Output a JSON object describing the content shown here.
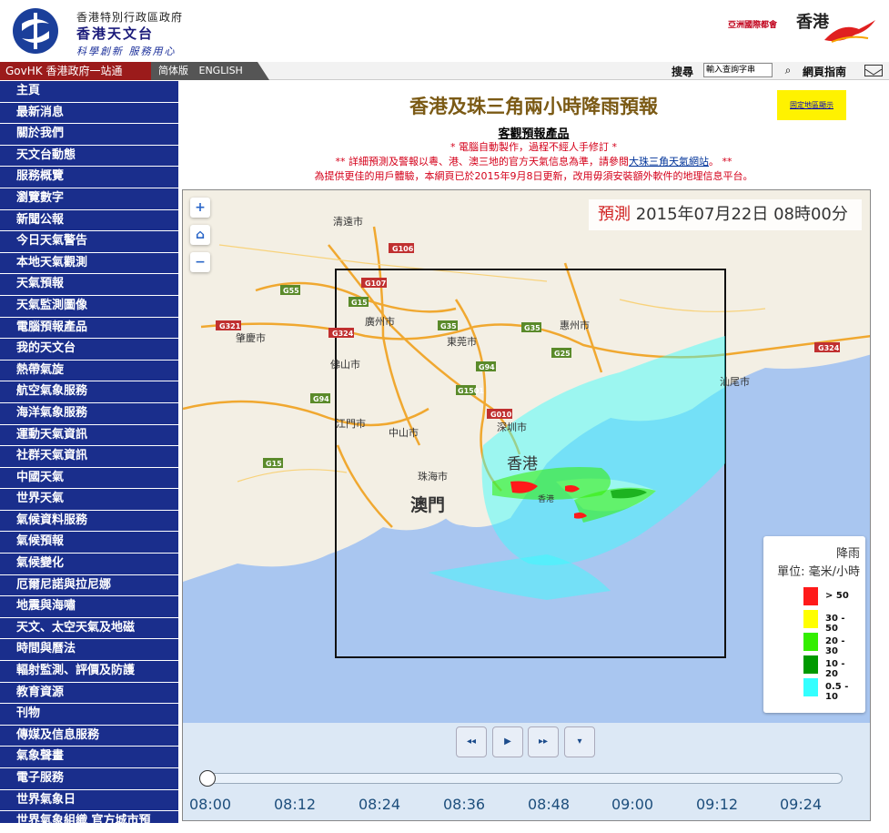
{
  "header": {
    "org_line1": "香港特別行政區政府",
    "org_line2": "香港天文台",
    "motto": "科學創新 服務用心",
    "asia_text": "亞洲國際都會",
    "brand": "香港"
  },
  "topbar": {
    "govhk": "GovHK 香港政府一站通",
    "lang_simplified": "简体版",
    "lang_english": "ENGLISH",
    "search_label": "搜尋",
    "search_placeholder": "輸入查詢字串",
    "site_guide": "網頁指南"
  },
  "sidebar": {
    "items": [
      "主頁",
      "最新消息",
      "關於我們",
      "天文台動態",
      "服務概覽",
      "瀏覽數字",
      "新聞公報",
      "今日天氣警告",
      "本地天氣觀測",
      "天氣預報",
      "天氣監測圖像",
      "電腦預報產品",
      "我的天文台",
      "熱帶氣旋",
      "航空氣象服務",
      "海洋氣象服務",
      "運動天氣資訊",
      "社群天氣資訊",
      "中國天氣",
      "世界天氣",
      "氣候資料服務",
      "氣候預報",
      "氣候變化",
      "厄爾尼諾與拉尼娜",
      "地震與海嘯",
      "天文、太空天氣及地磁",
      "時間與曆法",
      "輻射監測、評價及防護",
      "教育資源",
      "刊物",
      "傳媒及信息服務",
      "氣象聲畫",
      "電子服務",
      "世界氣象日",
      "世界氣象組織 官方城市預"
    ]
  },
  "main": {
    "title": "香港及珠三角兩小時降雨預報",
    "notice_button": "固定地區顯示",
    "subtitle": "客觀預報產品",
    "line1": "* 電腦自動製作，過程不經人手修訂 *",
    "line2_prefix": "** 詳細預測及警報以粵、港、澳三地的官方天氣信息為準，請參閱",
    "line2_link": "大珠三角天氣網站",
    "line2_suffix": "。 **",
    "line3": "為提供更佳的用戶體驗，本網頁已於2015年9月8日更新，改用毋須安裝額外軟件的地理信息平台。"
  },
  "map": {
    "forecast_label": "預測",
    "forecast_time": "2015年07月22日 08時00分",
    "zoom_in": "+",
    "home_label": "⌂",
    "zoom_out": "−",
    "cities": [
      "清遠市",
      "廣州市",
      "東莞市",
      "惠州市",
      "肇慶市",
      "佛山市",
      "江門市",
      "中山市",
      "深圳市",
      "珠海市",
      "香港",
      "澳門",
      "汕尾市",
      "香港"
    ],
    "roads": [
      "G106",
      "G107",
      "G55",
      "G15",
      "G35",
      "G321",
      "G324",
      "G25",
      "G94",
      "G1501",
      "G010",
      "G324",
      "G15",
      "G94",
      "G35"
    ]
  },
  "legend": {
    "title": "降雨",
    "unit": "單位: 毫米/小時",
    "rows": [
      {
        "label": "> 50",
        "color": "#ff1a1a"
      },
      {
        "label": "30 - 50",
        "color": "#ffff00"
      },
      {
        "label": "20 - 30",
        "color": "#33ee00"
      },
      {
        "label": "10 - 20",
        "color": "#009900"
      },
      {
        "label": "0.5 - 10",
        "color": "#33ffff"
      }
    ]
  },
  "timeline": {
    "buttons": [
      "◂◂",
      "▶",
      "▸▸",
      "▾"
    ],
    "labels": [
      "08:00",
      "08:12",
      "08:24",
      "08:36",
      "08:48",
      "09:00",
      "09:12",
      "09:24"
    ],
    "progress": 0
  }
}
